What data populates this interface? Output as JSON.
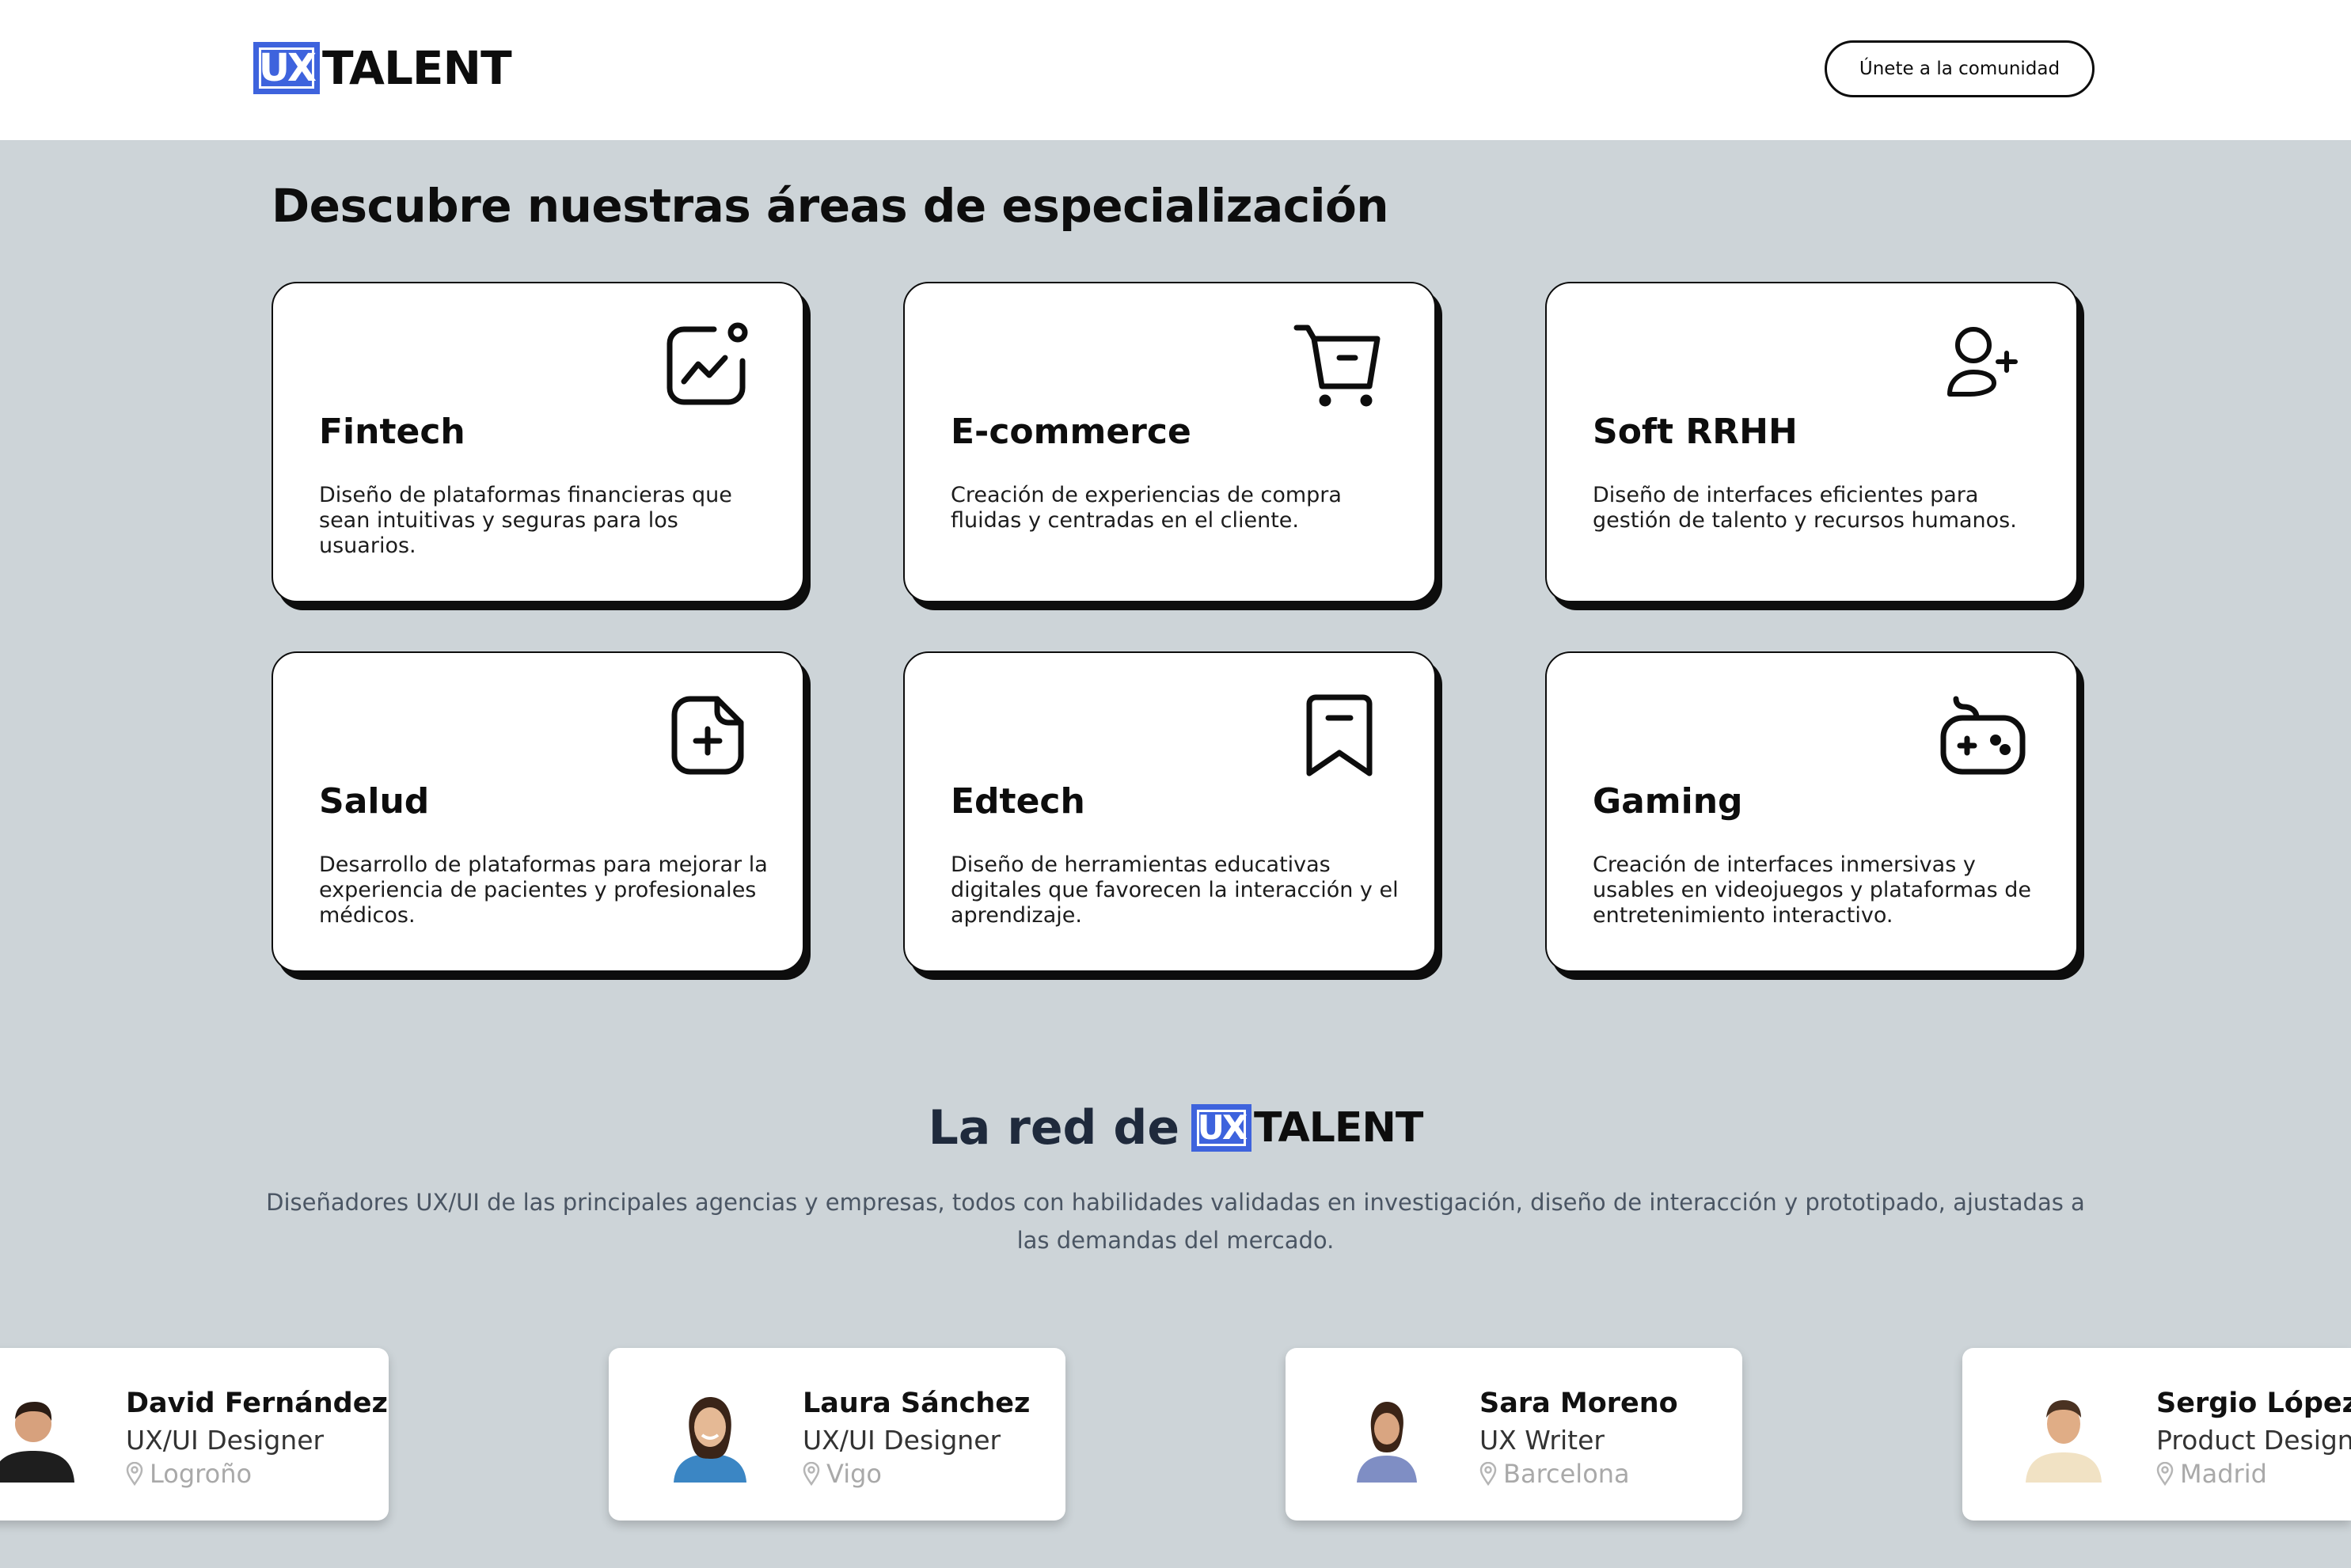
{
  "header": {
    "logo_ux": "UX",
    "logo_talent": "TALENT",
    "cta_label": "Únete a la comunidad"
  },
  "areas": {
    "title": "Descubre nuestras áreas de especialización",
    "cards": [
      {
        "title": "Fintech",
        "desc": "Diseño de plataformas financieras que sean intuitivas y seguras para los usuarios.",
        "icon": "chart-growth-icon"
      },
      {
        "title": "E-commerce",
        "desc": "Creación de experiencias de compra fluidas y centradas en el cliente.",
        "icon": "shopping-cart-icon"
      },
      {
        "title": "Soft RRHH",
        "desc": "Diseño de interfaces eficientes para gestión de talento y recursos humanos.",
        "icon": "user-add-icon"
      },
      {
        "title": "Salud",
        "desc": "Desarrollo de plataformas para mejorar la experiencia de pacientes y profesionales médicos.",
        "icon": "medical-note-icon"
      },
      {
        "title": "Edtech",
        "desc": "Diseño de herramientas educativas digitales que favorecen la interacción y el aprendizaje.",
        "icon": "bookmark-icon"
      },
      {
        "title": "Gaming",
        "desc": "Creación de interfaces inmersivas y usables en videojuegos y plataformas de entretenimiento interactivo.",
        "icon": "gamepad-icon"
      }
    ]
  },
  "network": {
    "title_prefix": "La red de",
    "logo_ux": "UX",
    "logo_talent": "TALENT",
    "subtitle": "Diseñadores UX/UI de las principales agencias y empresas, todos con habilidades validadas en investigación, diseño de interacción y prototipado, ajustadas a las demandas del mercado."
  },
  "profiles": [
    {
      "name": "David Fernández",
      "role": "UX/UI Designer",
      "location": "Logroño"
    },
    {
      "name": "Laura Sánchez",
      "role": "UX/UI Designer",
      "location": "Vigo"
    },
    {
      "name": "Sara Moreno",
      "role": "UX Writer",
      "location": "Barcelona"
    },
    {
      "name": "Sergio López",
      "role": "Product Designer",
      "location": "Madrid"
    }
  ],
  "colors": {
    "brand": "#3e63dd",
    "background": "#cdd4d8",
    "ink": "#0d0d0d"
  }
}
